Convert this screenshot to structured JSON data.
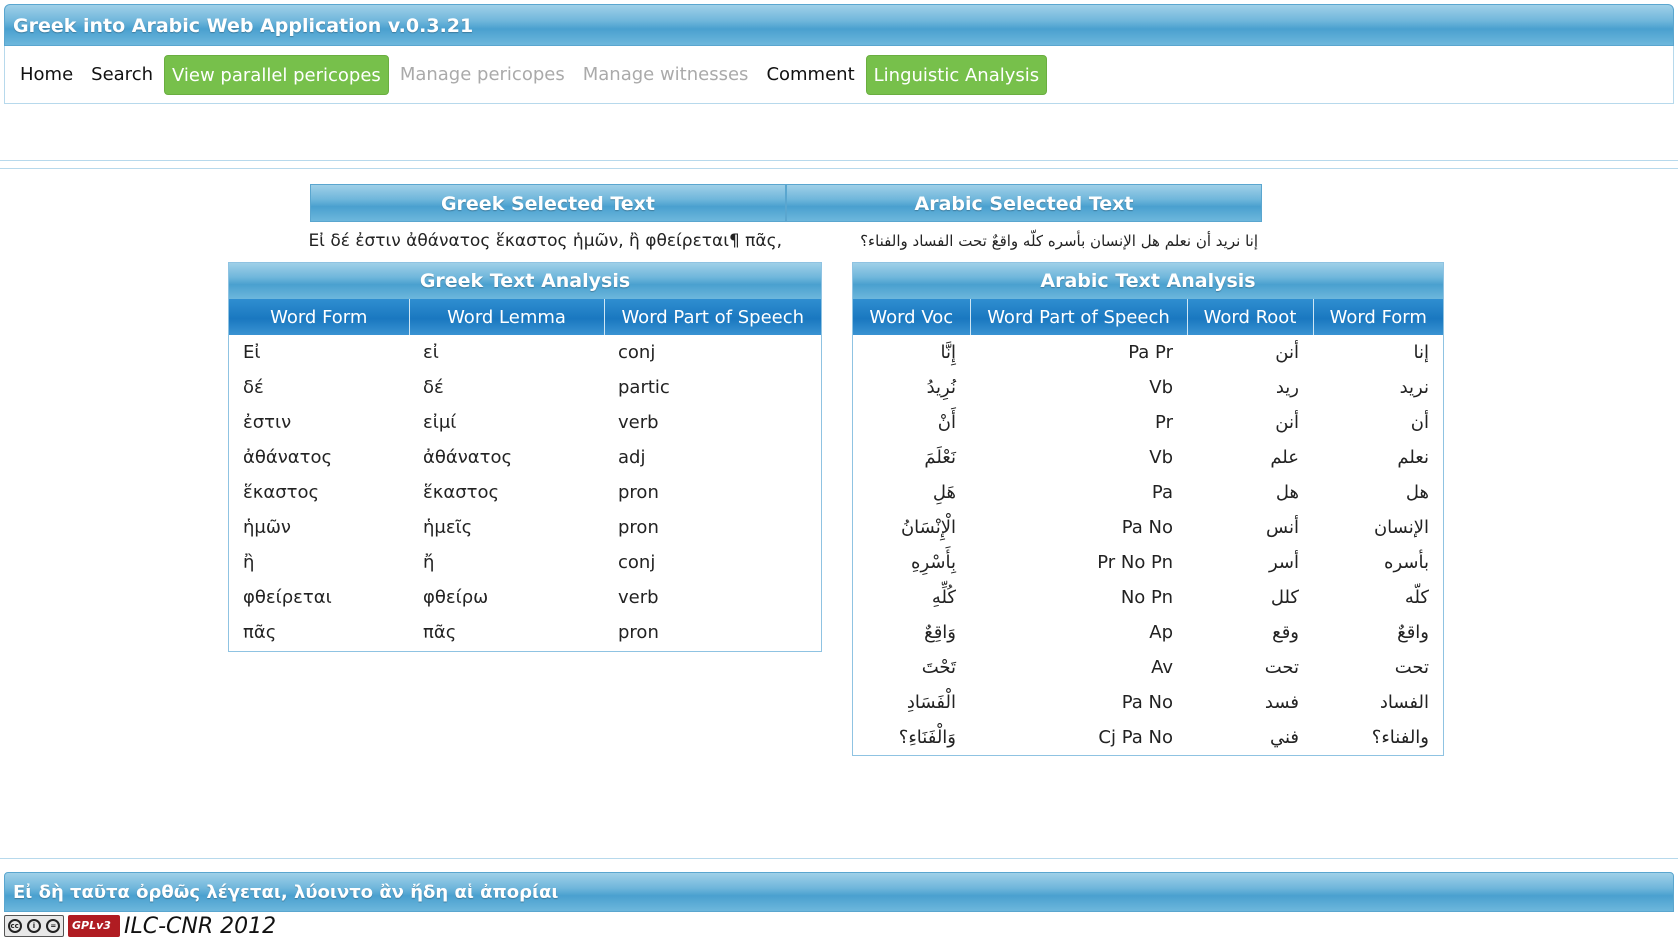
{
  "app": {
    "title": "Greek into Arabic Web Application v.0.3.21"
  },
  "nav": [
    {
      "label": "Home",
      "state": "normal"
    },
    {
      "label": "Search",
      "state": "normal"
    },
    {
      "label": "View parallel pericopes",
      "state": "active"
    },
    {
      "label": "Manage pericopes",
      "state": "disabled"
    },
    {
      "label": "Manage witnesses",
      "state": "disabled"
    },
    {
      "label": "Comment",
      "state": "normal"
    },
    {
      "label": "Linguistic Analysis",
      "state": "active"
    }
  ],
  "selected": {
    "greek_header": "Greek Selected Text",
    "arabic_header": "Arabic Selected Text",
    "greek_text": "Εἰ δέ ἐστιν ἀθάνατος ἕκαστος ἡμῶν, ἢ φθείρεται¶ πᾶς,",
    "arabic_text": "إنا نريد أن نعلم هل الإنسان بأسره كلّه واقعٌ تحت الفساد والفناء؟"
  },
  "greek_analysis": {
    "title": "Greek Text Analysis",
    "columns": [
      "Word Form",
      "Word Lemma",
      "Word Part of Speech"
    ],
    "rows": [
      [
        "Εἰ",
        "εἰ",
        "conj"
      ],
      [
        "δέ",
        "δέ",
        "partic"
      ],
      [
        "ἐστιν",
        "εἰμί",
        "verb"
      ],
      [
        "ἀθάνατος",
        "ἀθάνατος",
        "adj"
      ],
      [
        "ἕκαστος",
        "ἕκαστος",
        "pron"
      ],
      [
        "ἡμῶν",
        "ἡμεῖς",
        "pron"
      ],
      [
        "ἢ",
        "ἤ",
        "conj"
      ],
      [
        "φθείρεται",
        "φθείρω",
        "verb"
      ],
      [
        "πᾶς",
        "πᾶς",
        "pron"
      ]
    ]
  },
  "arabic_analysis": {
    "title": "Arabic Text Analysis",
    "columns": [
      "Word Voc",
      "Word Part of Speech",
      "Word Root",
      "Word Form"
    ],
    "rows": [
      [
        "إِنَّا",
        "Pa Pr",
        "أنن",
        "إنا"
      ],
      [
        "نُرِيدُ",
        "Vb",
        "ريد",
        "نريد"
      ],
      [
        "أَنْ",
        "Pr",
        "أنن",
        "أن"
      ],
      [
        "نَعْلَمَ",
        "Vb",
        "علم",
        "نعلم"
      ],
      [
        "هَلِ",
        "Pa",
        "هل",
        "هل"
      ],
      [
        "الْإِنْسَانُ",
        "Pa No",
        "أنس",
        "الإنسان"
      ],
      [
        "بِأَسْرِهِ",
        "Pr No Pn",
        "أسر",
        "بأسره"
      ],
      [
        "كُلِّهِ",
        "No Pn",
        "كلل",
        "كلّه"
      ],
      [
        "وَاقِعٌ",
        "Ap",
        "وقع",
        "واقعٌ"
      ],
      [
        "تَحْتَ",
        "Av",
        "تحت",
        "تحت"
      ],
      [
        "الْفَسَادِ",
        "Pa No",
        "فسد",
        "الفساد"
      ],
      [
        "وَالْفَنَاءِ؟",
        "Cj Pa No",
        "فني",
        "والفناء؟"
      ]
    ]
  },
  "footer": {
    "banner": "Εἰ δὴ ταῦτα ὀρθῶς λέγεται, λύοιντο ἂν ἤδη αἱ ἀπορίαι",
    "credit": "ILC-CNR 2012",
    "cc_badge": "cc-by-sa-icon",
    "gpl_badge": "GPLv3"
  }
}
